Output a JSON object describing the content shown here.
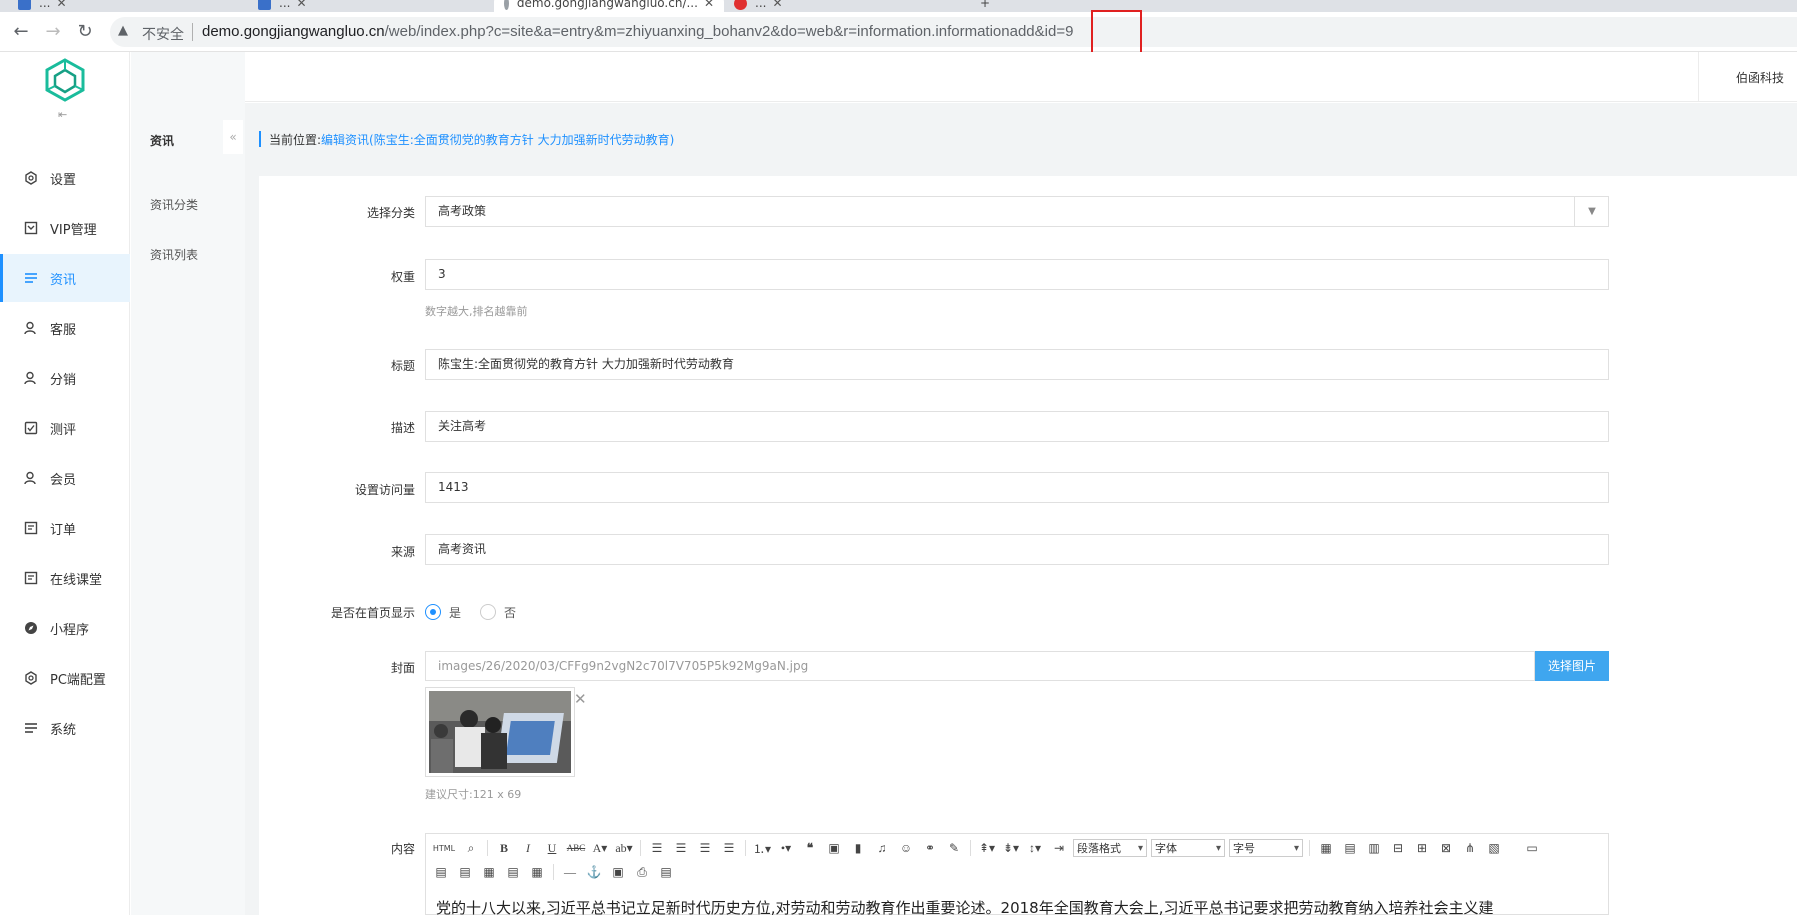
{
  "browser": {
    "tabs": [
      {
        "label": "..."
      },
      {
        "label": "..."
      },
      {
        "label": "demo.gongjiangwangluo.cn/..."
      },
      {
        "label": "..."
      }
    ],
    "insecure_label": "不安全",
    "url_host": "demo.gongjiangwangluo.cn",
    "url_path": "/web/index.php?c=site&a=entry&m=zhiyuanxing_bohanv2&do=web&r=information.informationadd&id=9"
  },
  "sidebar": {
    "items": [
      {
        "label": "设置",
        "icon": "gear-icon"
      },
      {
        "label": "VIP管理",
        "icon": "vip-icon"
      },
      {
        "label": "资讯",
        "icon": "list-icon"
      },
      {
        "label": "客服",
        "icon": "user-icon"
      },
      {
        "label": "分销",
        "icon": "user-icon"
      },
      {
        "label": "测评",
        "icon": "check-icon"
      },
      {
        "label": "会员",
        "icon": "user-icon"
      },
      {
        "label": "订单",
        "icon": "order-icon"
      },
      {
        "label": "在线课堂",
        "icon": "order-icon"
      },
      {
        "label": "小程序",
        "icon": "compass-icon"
      },
      {
        "label": "PC端配置",
        "icon": "gear-icon"
      },
      {
        "label": "系统",
        "icon": "list-icon"
      }
    ]
  },
  "subnav": {
    "title": "资讯",
    "items": [
      {
        "label": "资讯分类"
      },
      {
        "label": "资讯列表"
      }
    ]
  },
  "topbar": {
    "company": "伯函科技"
  },
  "breadcrumb": {
    "prefix": "当前位置:",
    "path": "编辑资讯(陈宝生:全面贯彻党的教育方针 大力加强新时代劳动教育)"
  },
  "form": {
    "category": {
      "label": "选择分类",
      "value": "高考政策"
    },
    "weight": {
      "label": "权重",
      "value": "3",
      "help": "数字越大,排名越靠前"
    },
    "title": {
      "label": "标题",
      "value": "陈宝生:全面贯彻党的教育方针 大力加强新时代劳动教育"
    },
    "description": {
      "label": "描述",
      "value": "关注高考"
    },
    "views": {
      "label": "设置访问量",
      "value": "1413"
    },
    "source": {
      "label": "来源",
      "value": "高考资讯"
    },
    "show_home": {
      "label": "是否在首页显示",
      "yes": "是",
      "no": "否",
      "selected": "是"
    },
    "cover": {
      "label": "封面",
      "value": "images/26/2020/03/CFFg9n2vgN2c70l7V705P5k92Mg9aN.jpg",
      "button": "选择图片",
      "size_hint": "建议尺寸:121 x 69"
    },
    "content": {
      "label": "内容",
      "toolbar": {
        "html": "HTML",
        "paragraph_format": "段落格式",
        "font": "字体",
        "font_size": "字号"
      },
      "body": "党的十八大以来,习近平总书记立足新时代历史方位,对劳动和劳动教育作出重要论述。2018年全国教育大会上,习近平总书记要求把劳动教育纳入培养社会主义建"
    }
  },
  "colors": {
    "accent": "#1e90ff",
    "button": "#3fa6ef",
    "highlight": "#e02020"
  }
}
